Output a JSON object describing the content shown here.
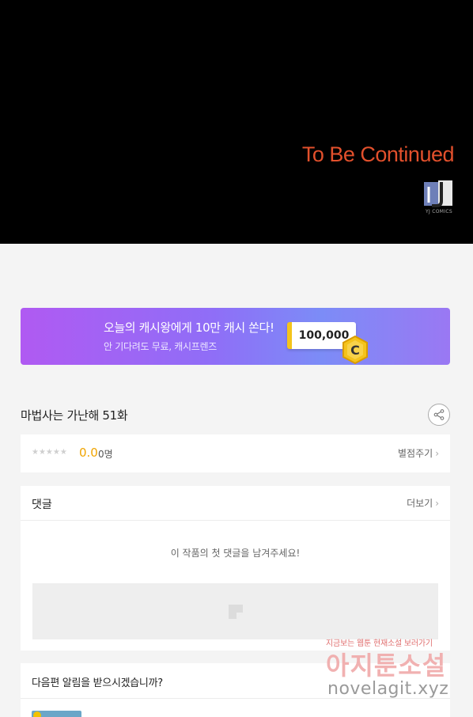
{
  "comic": {
    "to_be_continued": "To Be Continued",
    "publisher_logo_text": "YJ COMICS"
  },
  "banner": {
    "title": "오늘의 캐시왕에게 10만 캐시 쏜다!",
    "subtitle": "안 기다려도 무료, 캐시프렌즈",
    "cash_amount": "100,000",
    "coin_letter": "C"
  },
  "episode": {
    "title": "마법사는 가난해 51화",
    "share_icon": "share-icon"
  },
  "rating": {
    "stars": "★★★★★",
    "score": "0.0",
    "count": "0명",
    "rate_label": "별점주기"
  },
  "comments": {
    "title": "댓글",
    "more_label": "더보기",
    "empty_message": "이 작품의 첫 댓글을 남겨주세요!"
  },
  "notify": {
    "question": "다음편 알림을 받으시겠습니까?"
  },
  "watermark": {
    "line1": "지금보는 웹툰 현재소설 보러가기",
    "line2": "아지툰소설",
    "line3": "novelagit.xyz"
  },
  "colors": {
    "accent_orange": "#e2502c",
    "rating_score": "#f0a400",
    "banner_start": "#b05af2",
    "banner_end": "#7c8cf7"
  }
}
